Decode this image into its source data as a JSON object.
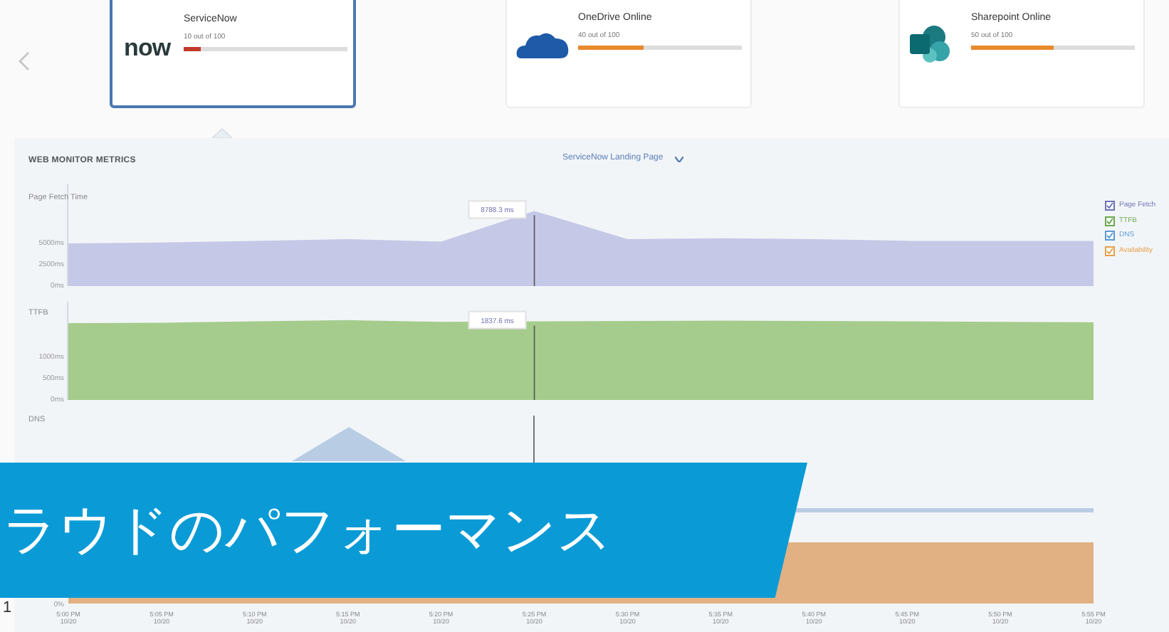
{
  "cards": [
    {
      "logo_text": "now",
      "name": "ServiceNow",
      "score": "10 out of 100",
      "level": 0.1,
      "color": "#c0392b",
      "selected": true
    },
    {
      "name": "OneDrive Online",
      "score": "40 out of 100",
      "level": 0.4,
      "color": "#e8892c",
      "selected": false
    },
    {
      "name": "Sharepoint Online",
      "score": "50 out of 100",
      "level": 0.5,
      "color": "#e8892c",
      "selected": false
    }
  ],
  "panel": {
    "title": "WEB MONITOR METRICS",
    "page_select": "ServiceNow Landing Page",
    "charts": [
      {
        "tooltip": "8788.3 ms",
        "chart_data": {
          "type": "area",
          "title": "Page Fetch Time",
          "ylim": [
            0,
            12000
          ],
          "series": [
            {
              "color": "#c5c8e6",
              "values": [
                5000,
                5100,
                5300,
                5500,
                5200,
                8800,
                5500,
                5600,
                5500,
                5300,
                5300,
                5300
              ]
            }
          ],
          "yticks": [
            {
              "value": 0,
              "label": "0ms"
            },
            {
              "value": 2500,
              "label": "2500ms"
            },
            {
              "value": 5000,
              "label": "5000ms"
            }
          ]
        }
      },
      {
        "tooltip": "1837.6 ms",
        "chart_data": {
          "type": "area",
          "title": "TTFB",
          "ylim": [
            0,
            2300
          ],
          "series": [
            {
              "color": "#a5cc8c",
              "values": [
                1800,
                1810,
                1840,
                1870,
                1830,
                1840,
                1850,
                1860,
                1850,
                1840,
                1830,
                1820
              ]
            }
          ],
          "yticks": [
            {
              "value": 0,
              "label": "0ms"
            },
            {
              "value": 500,
              "label": "500ms"
            },
            {
              "value": 1000,
              "label": "1000ms"
            }
          ]
        }
      }
    ],
    "dns": {
      "title": "DNS",
      "y_label": "0%",
      "time_axis": [
        {
          "time": "5:00 PM",
          "date": "10/20"
        },
        {
          "time": "5:05 PM",
          "date": "10/20"
        },
        {
          "time": "5:10 PM",
          "date": "10/20"
        },
        {
          "time": "5:15 PM",
          "date": "10/20"
        },
        {
          "time": "5:20 PM",
          "date": "10/20"
        },
        {
          "time": "5:25 PM",
          "date": "10/20"
        },
        {
          "time": "5:30 PM",
          "date": "10/20"
        },
        {
          "time": "5:35 PM",
          "date": "10/20"
        },
        {
          "time": "5:40 PM",
          "date": "10/20"
        },
        {
          "time": "5:45 PM",
          "date": "10/20"
        },
        {
          "time": "5:50 PM",
          "date": "10/20"
        },
        {
          "time": "5:55 PM",
          "date": "10/20"
        }
      ]
    },
    "legend": [
      {
        "label": "Page Fetch",
        "checked": true,
        "color": "#6f73b8"
      },
      {
        "label": "TTFB",
        "checked": true,
        "color": "#6aa84f"
      },
      {
        "label": "DNS",
        "checked": true,
        "color": "#5b9bd5"
      },
      {
        "label": "Availability",
        "checked": true,
        "color": "#e6a04a"
      }
    ]
  },
  "edge_mark": "1",
  "banner": {
    "text": "ラウドのパフォーマンス"
  }
}
